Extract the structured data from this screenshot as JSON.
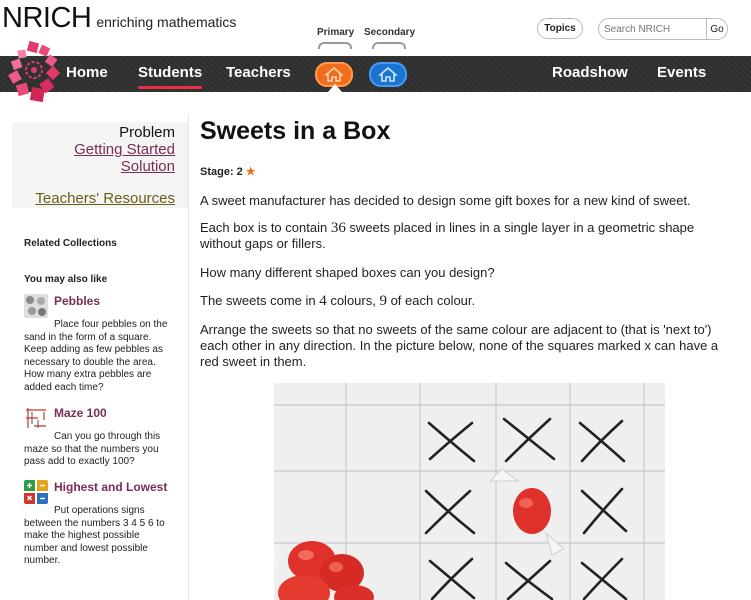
{
  "header": {
    "brand_name": "NRICH",
    "brand_tagline": "enriching mathematics",
    "primary_label": "Primary",
    "secondary_label": "Secondary",
    "topics_label": "Topics",
    "search_placeholder": "Search NRICH",
    "go_label": "Go"
  },
  "nav": {
    "items": [
      {
        "label": "Home"
      },
      {
        "label": "Students",
        "active": true
      },
      {
        "label": "Teachers"
      },
      {
        "label": "Roadshow"
      },
      {
        "label": "Events"
      }
    ],
    "primary_home_icon": "house-icon",
    "secondary_home_icon": "house-icon",
    "primary_color": "#f26c1d",
    "secondary_color": "#1a74d2",
    "bar_color": "#2f2f2f",
    "active_underline_color": "#e53048"
  },
  "sidebar": {
    "problem": "Problem",
    "getting_started": "Getting Started",
    "solution": "Solution",
    "teachers_resources": "Teachers' Resources",
    "related_collections": "Related Collections",
    "you_may_also_like": "You may also like",
    "also_like": [
      {
        "title": "Pebbles",
        "description": "Place four pebbles on the sand in the form of a square. Keep adding as few pebbles as necessary to double the area. How many extra pebbles are added each time?",
        "icon": "pebbles-thumbnail"
      },
      {
        "title": "Maze 100",
        "description": "Can you go through this maze so that the numbers you pass add to exactly 100?",
        "icon": "maze-thumbnail"
      },
      {
        "title": "Highest and Lowest",
        "description": "Put operations signs between the numbers 3 4 5 6 to make the highest possible number and lowest possible number.",
        "icon": "operations-thumbnail"
      }
    ]
  },
  "main": {
    "title": "Sweets in a Box",
    "stage_label": "Stage: 2",
    "stage_icon": "star-icon",
    "p1": "A sweet manufacturer has decided to design some gift boxes for a new kind of sweet.",
    "p2_a": "Each box is to contain ",
    "p2_num": "36",
    "p2_b": " sweets placed in lines in a single layer in a geometric shape without gaps or fillers.",
    "p3": "How many different shaped boxes can you design?",
    "p4_a": "The sweets come in ",
    "p4_num1": "4",
    "p4_b": " colours, ",
    "p4_num2": "9",
    "p4_c": " of each colour.",
    "p5": "Arrange the sweets so that no sweets of the same colour are adjacent to (that is 'next to') each other in any direction. In the picture below, none of the squares marked x can have a red sweet in them."
  }
}
